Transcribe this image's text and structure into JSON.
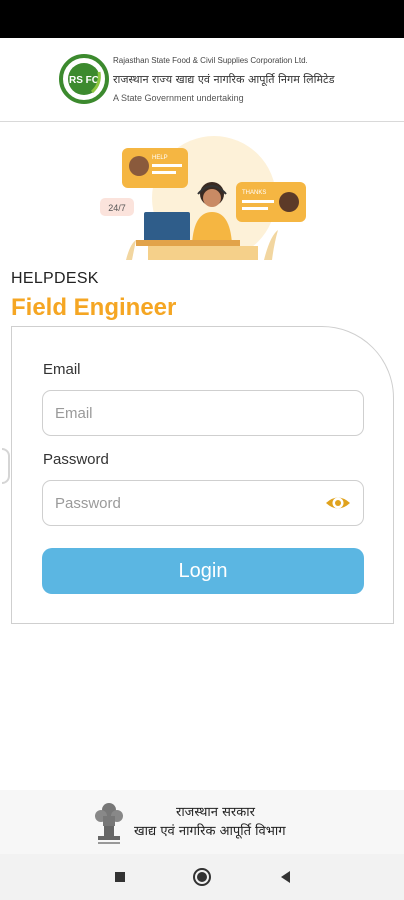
{
  "header": {
    "logo_letters": "RS FC",
    "org_name_en": "Rajasthan State Food & Civil Supplies Corporation Ltd.",
    "org_name_hi": "राजस्थान राज्य खाद्य एवं नागरिक आपूर्ति निगम लिमिटेड",
    "tagline": "A State Government undertaking"
  },
  "illustration": {
    "bubble_left": "HELP",
    "bubble_right": "THANKS",
    "badge": "24/7"
  },
  "page": {
    "section_label": "HELPDESK",
    "title": "Field Engineer"
  },
  "form": {
    "email_label": "Email",
    "email_placeholder": "Email",
    "email_value": "",
    "password_label": "Password",
    "password_placeholder": "Password",
    "password_value": "",
    "login_label": "Login"
  },
  "footer": {
    "line1": "राजस्थान सरकार",
    "line2": "खाद्य एवं नागरिक आपूर्ति विभाग"
  },
  "colors": {
    "accent_orange": "#f5a623",
    "button_blue": "#5bb6e2",
    "logo_green": "#3c8a2e"
  },
  "icons": {
    "password_toggle": "eye-icon",
    "nav": [
      "square-icon",
      "circle-icon",
      "triangle-back-icon"
    ]
  }
}
